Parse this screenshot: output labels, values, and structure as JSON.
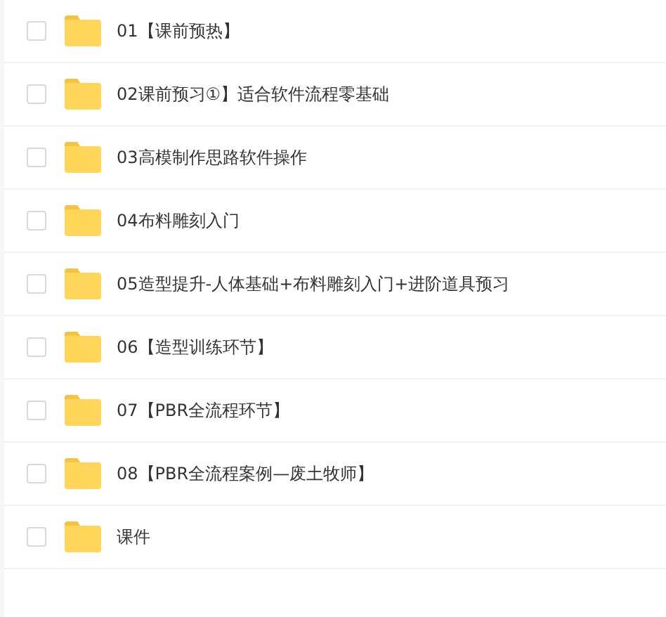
{
  "files": [
    {
      "name": "01【课前预热】",
      "checked": false
    },
    {
      "name": "02课前预习①】适合软件流程零基础",
      "checked": false
    },
    {
      "name": "03高模制作思路软件操作",
      "checked": false
    },
    {
      "name": "04布料雕刻入门",
      "checked": false
    },
    {
      "name": "05造型提升-人体基础+布料雕刻入门+进阶道具预习",
      "checked": false
    },
    {
      "name": "06【造型训练环节】",
      "checked": false
    },
    {
      "name": "07【PBR全流程环节】",
      "checked": false
    },
    {
      "name": "08【PBR全流程案例—废土牧师】",
      "checked": false
    },
    {
      "name": "课件",
      "checked": false
    }
  ]
}
